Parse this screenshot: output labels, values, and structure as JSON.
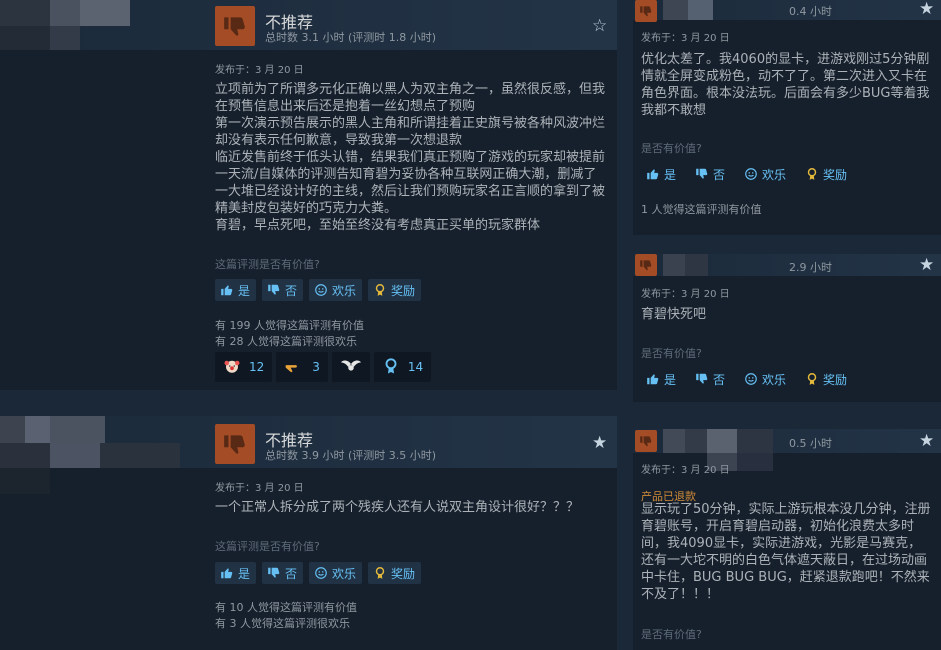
{
  "labels": {
    "not_recommended": "不推荐",
    "helpful_question": "这篇评测是否有价值?",
    "helpful_question_short": "是否有价值?",
    "yes": "是",
    "no": "否",
    "funny": "欢乐",
    "award": "奖励"
  },
  "reviews": [
    {
      "verdict": "不推荐",
      "hours": "总时数 3.1 小时  (评测时 1.8 小时)",
      "posted": "发布于：3 月 20 日",
      "body": "立项前为了所谓多元化正确以黑人为双主角之一，虽然很反感，但我\n在预售信息出来后还是抱着一丝幻想点了预购\n第一次演示预告展示的黑人主角和所谓挂着正史旗号被各种风波冲烂\n却没有表示任何歉意，导致我第一次想退款\n临近发售前终于低头认错，结果我们真正预购了游戏的玩家却被提前\n一天流/自媒体的评测告知育碧为妥协各种互联网正确大潮，删减了\n一大堆已经设计好的主线，然后让我们预购玩家名正言顺的拿到了被\n精美封皮包装好的巧克力大粪。\n育碧，早点死吧，至始至终没有考虑真正买单的玩家群体",
      "helpful_count": "有 199 人觉得这篇评测有价值",
      "funny_count": "有 28 人觉得这篇评测很欢乐",
      "awards": [
        "12",
        "3",
        "",
        "14"
      ]
    },
    {
      "verdict": "不推荐",
      "hours": "总时数 3.9 小时  (评测时 3.5 小时)",
      "posted": "发布于：3 月 20 日",
      "body": "一个正常人拆分成了两个残疾人还有人说双主角设计很好？？？",
      "helpful_count": "有 10 人觉得这篇评测有价值",
      "funny_count": "有 3 人觉得这篇评测很欢乐"
    }
  ],
  "side_reviews": [
    {
      "hours": "0.4 小时",
      "posted": "发布于：3 月 20 日",
      "body": "优化太差了。我4060的显卡，进游戏刚过5分钟剧\n情就全屏变成粉色，动不了了。第二次进入又卡在\n角色界面。根本没法玩。后面会有多少BUG等着我\n我都不敢想",
      "helpful_count": "1 人觉得这篇评测有价值"
    },
    {
      "hours": "2.9 小时",
      "posted": "发布于：3 月 20 日",
      "body": "育碧快死吧"
    },
    {
      "hours": "0.5 小时",
      "posted": "发布于：3 月 20 日",
      "refunded": "产品已退款",
      "body": "显示玩了50分钟，实际上游玩根本没几分钟，注册\n育碧账号，开启育碧启动器，初始化浪费太多时\n间，我4090显卡，实际进游戏，光影是马赛克，\n还有一大坨不明的白色气体遮天蔽日，在过场动画\n中卡住，BUG BUG BUG，赶紧退款跑吧！不然来\n不及了！！！"
    }
  ],
  "colors": {
    "background": "#1b2838",
    "card": "#16202d",
    "accent_blue": "#66c0f4",
    "thumb_red": "#a34c25",
    "refund_orange": "#d08a37"
  },
  "icons": [
    "thumbs-down-icon",
    "thumbs-up-icon",
    "smiley-icon",
    "award-icon",
    "star-icon",
    "avatar-pixelated"
  ]
}
